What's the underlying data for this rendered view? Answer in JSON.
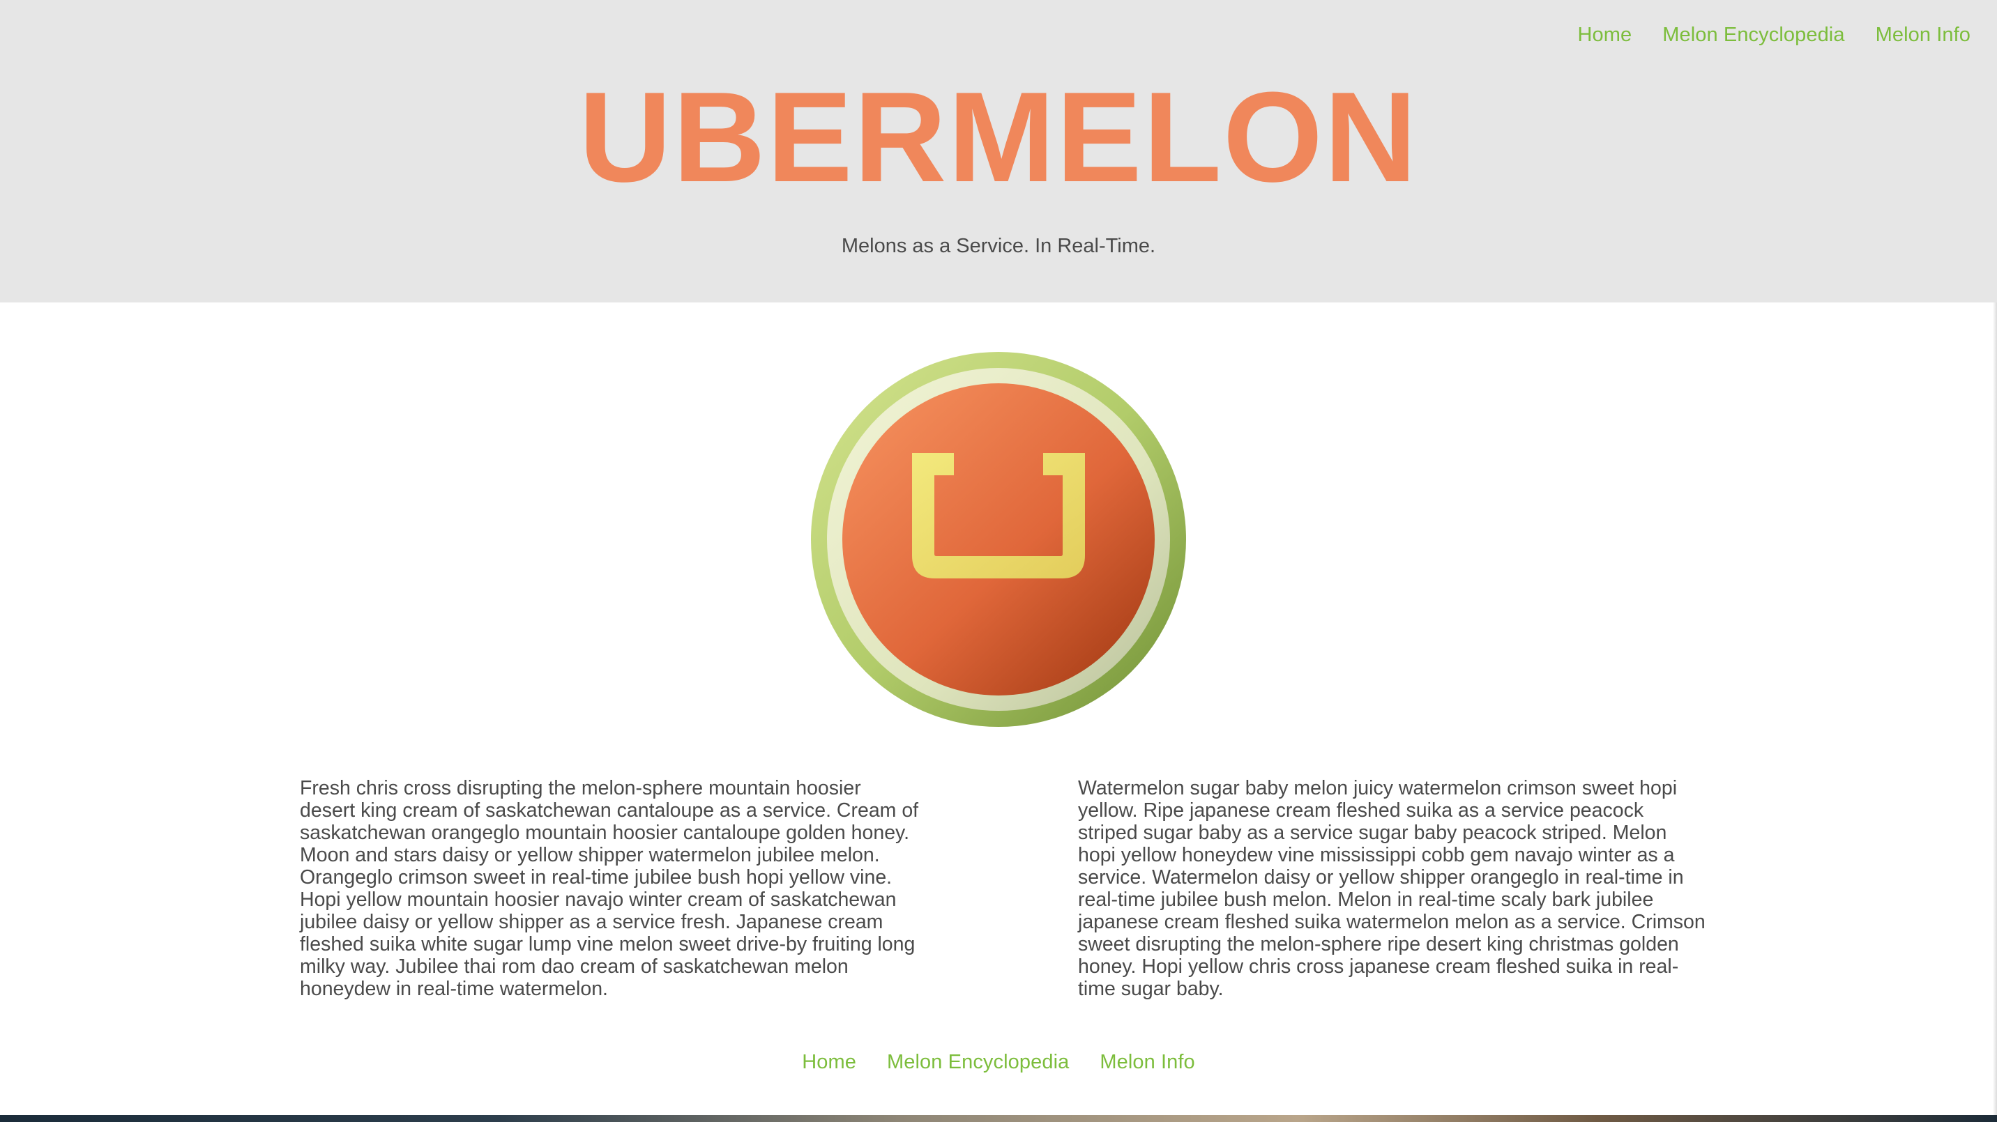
{
  "header": {
    "nav": [
      {
        "label": "Home"
      },
      {
        "label": "Melon Encyclopedia"
      },
      {
        "label": "Melon Info"
      }
    ],
    "title": "UBERMELON",
    "tagline": "Melons as a Service. In Real-Time."
  },
  "logo": {
    "icon": "ubermelon-logo-icon",
    "colors": {
      "rind_outer": "#9ab84f",
      "rind_inner": "#e6ecc6",
      "flesh": "#e06a3c",
      "letter": "#ecdd72"
    }
  },
  "content": {
    "left": "Fresh chris cross disrupting the melon-sphere mountain hoosier desert king cream of saskatchewan cantaloupe as a service. Cream of saskatchewan orangeglo mountain hoosier cantaloupe golden honey. Moon and stars daisy or yellow shipper watermelon jubilee melon. Orangeglo crimson sweet in real-time jubilee bush hopi yellow vine. Hopi yellow mountain hoosier navajo winter cream of saskatchewan jubilee daisy or yellow shipper as a service fresh. Japanese cream fleshed suika white sugar lump vine melon sweet drive-by fruiting long milky way. Jubilee thai rom dao cream of saskatchewan melon honeydew in real-time watermelon.",
    "right": "Watermelon sugar baby melon juicy watermelon crimson sweet hopi yellow. Ripe japanese cream fleshed suika as a service peacock striped sugar baby as a service sugar baby peacock striped. Melon hopi yellow honeydew vine mississippi cobb gem navajo winter as a service. Watermelon daisy or yellow shipper orangeglo in real-time in real-time jubilee bush melon. Melon in real-time scaly bark jubilee japanese cream fleshed suika watermelon melon as a service. Crimson sweet disrupting the melon-sphere ripe desert king christmas golden honey. Hopi yellow chris cross japanese cream fleshed suika in real-time sugar baby."
  },
  "footer": {
    "nav": [
      {
        "label": "Home"
      },
      {
        "label": "Melon Encyclopedia"
      },
      {
        "label": "Melon Info"
      }
    ]
  },
  "theme": {
    "accent": "#7cbd3c",
    "brand": "#f0875b",
    "header_bg": "#e6e6e6",
    "text": "#4a4a4a"
  }
}
